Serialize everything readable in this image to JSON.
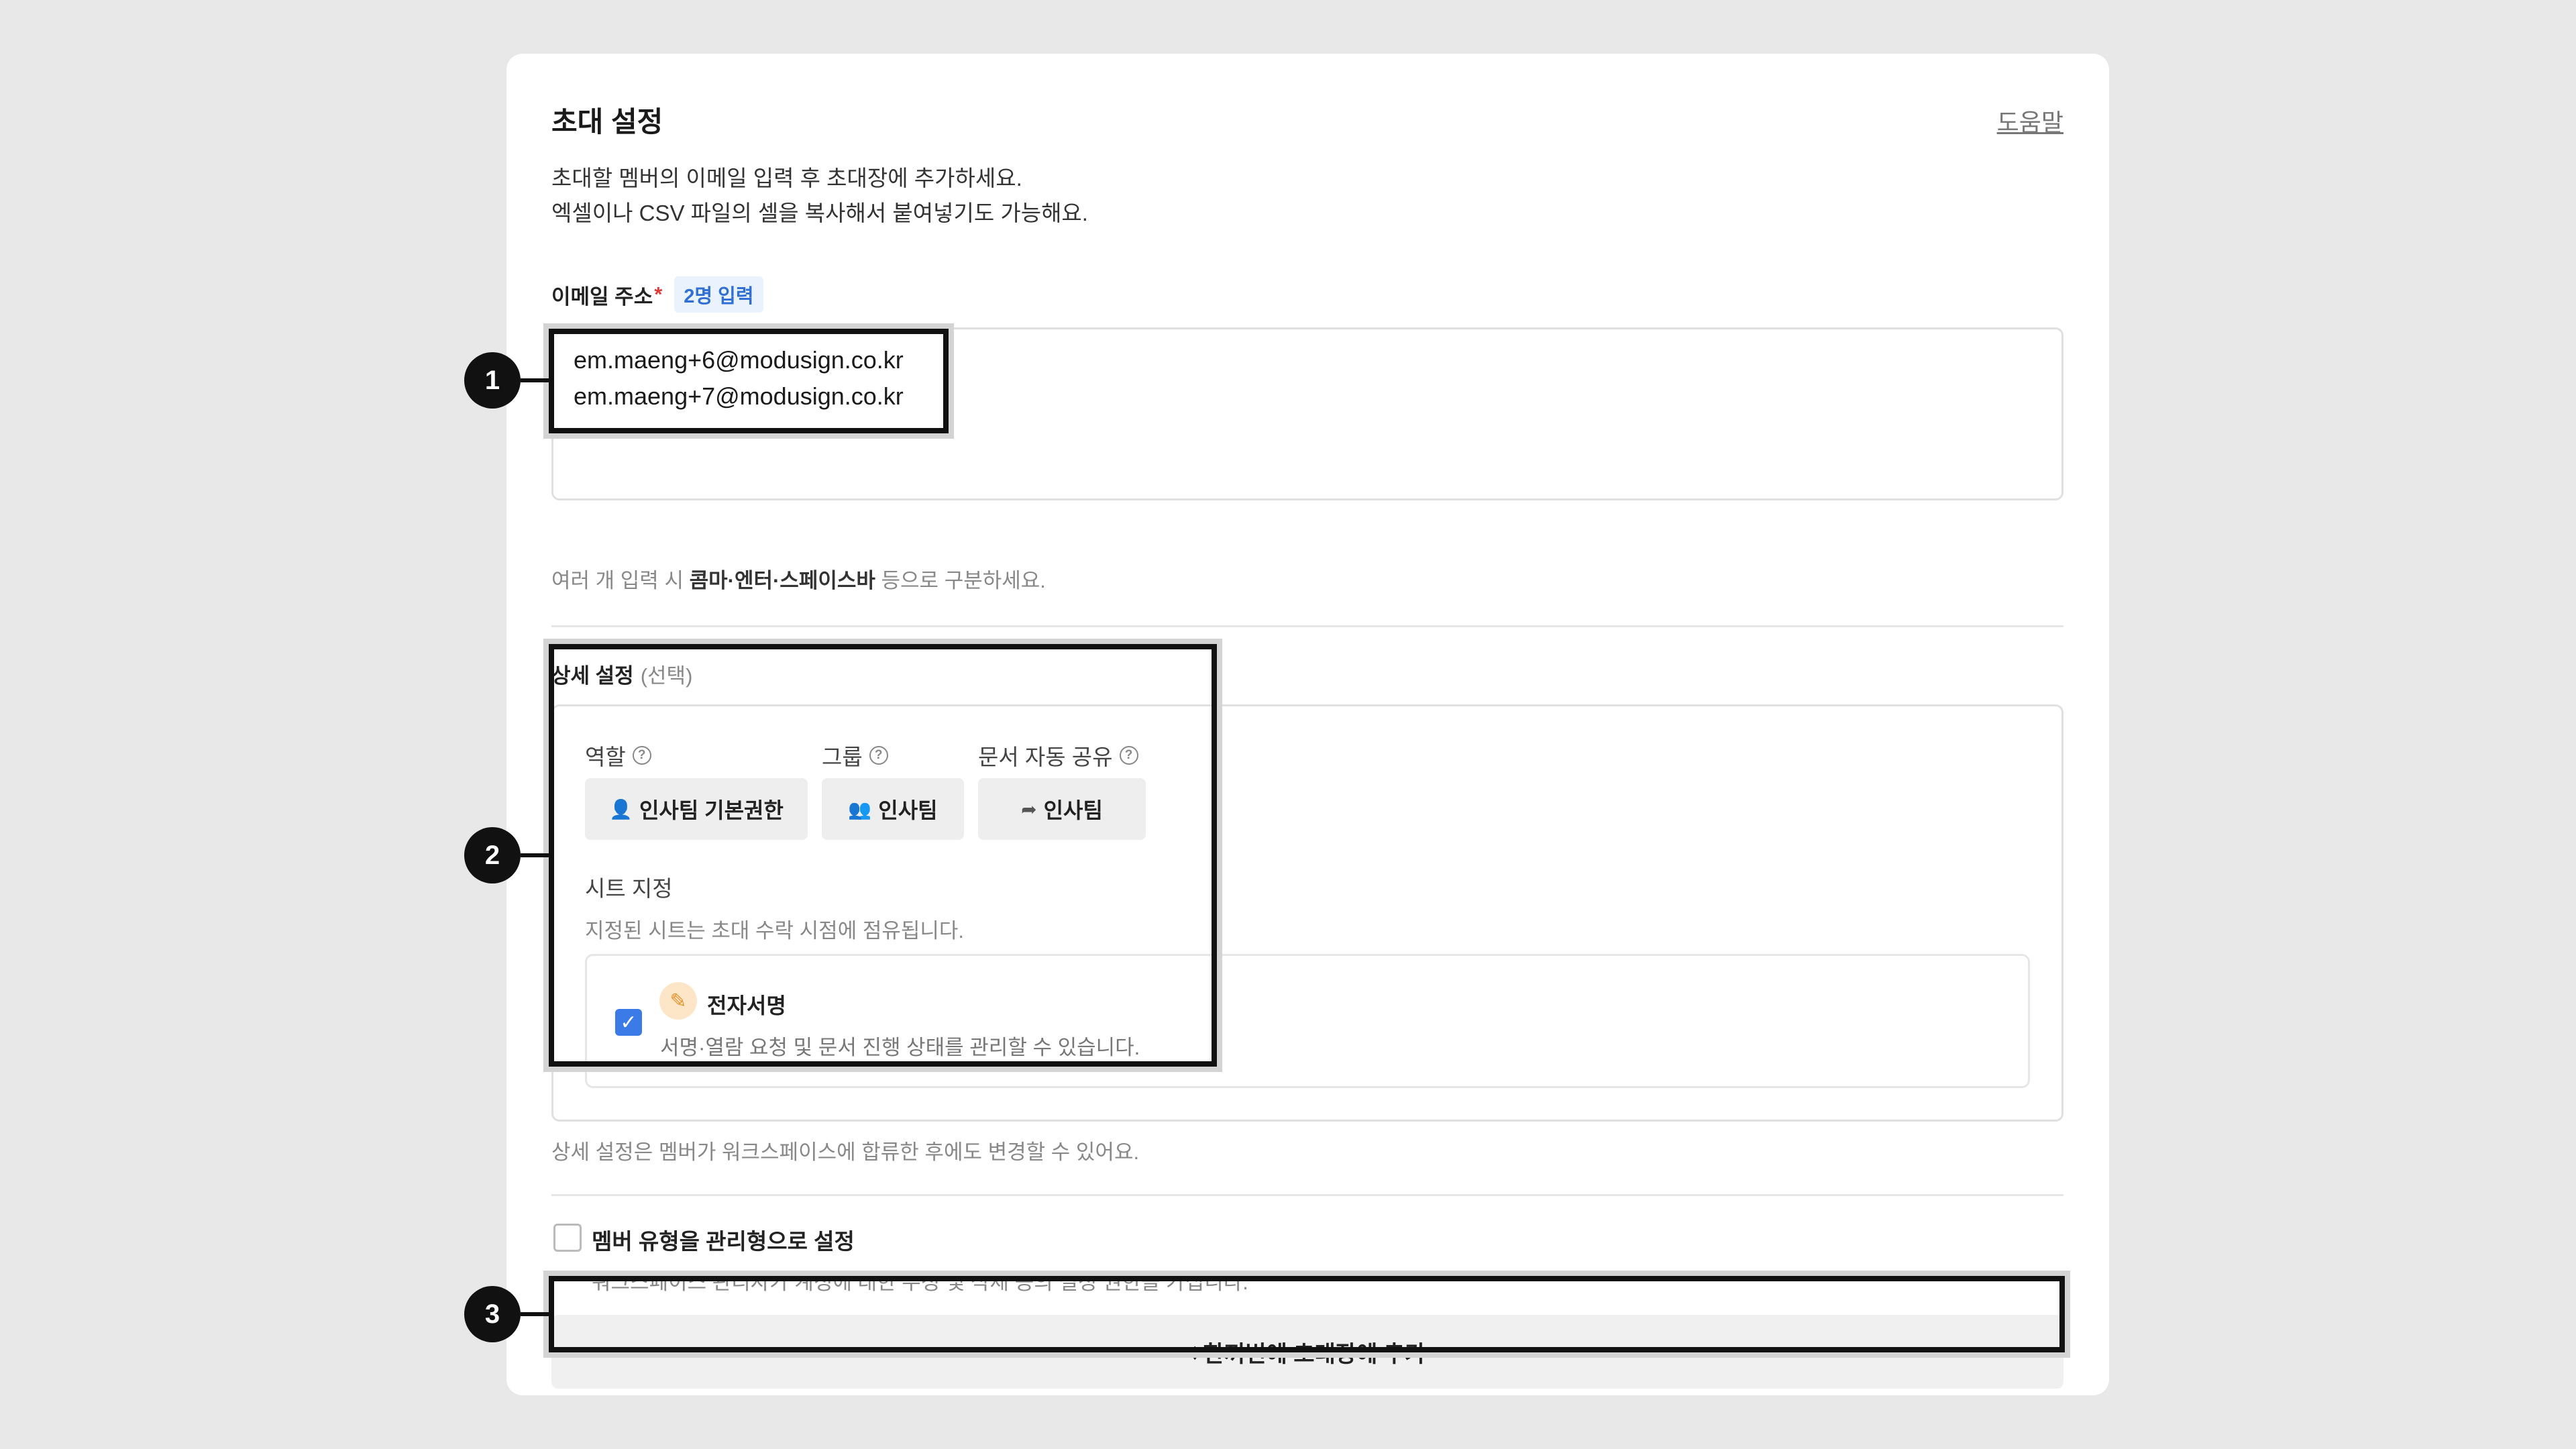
{
  "header": {
    "title": "초대 설정",
    "help_link": "도움말",
    "desc_line1": "초대할 멤버의 이메일 입력 후 초대장에 추가하세요.",
    "desc_line2": "엑셀이나 CSV 파일의 셀을 복사해서 붙여넣기도 가능해요."
  },
  "email": {
    "label": "이메일 주소",
    "required_mark": "*",
    "count_badge": "2명 입력",
    "lines": [
      "em.maeng+6@modusign.co.kr",
      "em.maeng+7@modusign.co.kr"
    ],
    "hint_prefix": "여러 개 입력 시 ",
    "hint_bold": "콤마·엔터·스페이스바",
    "hint_suffix": " 등으로 구분하세요."
  },
  "detail": {
    "label": "상세 설정",
    "label_optional": "(선택)",
    "role_label": "역할",
    "role_value": "인사팀 기본권한",
    "group_label": "그룹",
    "group_value": "인사팀",
    "share_label": "문서 자동 공유",
    "share_value": "인사팀",
    "seat_title": "시트 지정",
    "seat_sub": "지정된 시트는 초대 수락 시점에 점유됩니다.",
    "esign_title": "전자서명",
    "esign_desc": "서명·열람 요청 및 문서 진행 상태를 관리할 수 있습니다.",
    "esign_checked": true,
    "footer_hint": "상세 설정은 멤버가 워크스페이스에 합류한 후에도 변경할 수 있어요."
  },
  "admin": {
    "label": "멤버 유형을 관리형으로 설정",
    "desc": "워크스페이스 관리자가 계정에 대한 수정 및 삭제 등의 설정 권한을 가집니다.",
    "checked": false
  },
  "add_button": {
    "arrow": "↓",
    "label": "한꺼번에 초대장에 추가"
  },
  "callouts": [
    "1",
    "2",
    "3"
  ],
  "colors": {
    "accent_blue": "#3b7be8",
    "badge_text": "#2f6fd6",
    "required_red": "#e03b3b",
    "esign_orange": "#e8922a"
  }
}
